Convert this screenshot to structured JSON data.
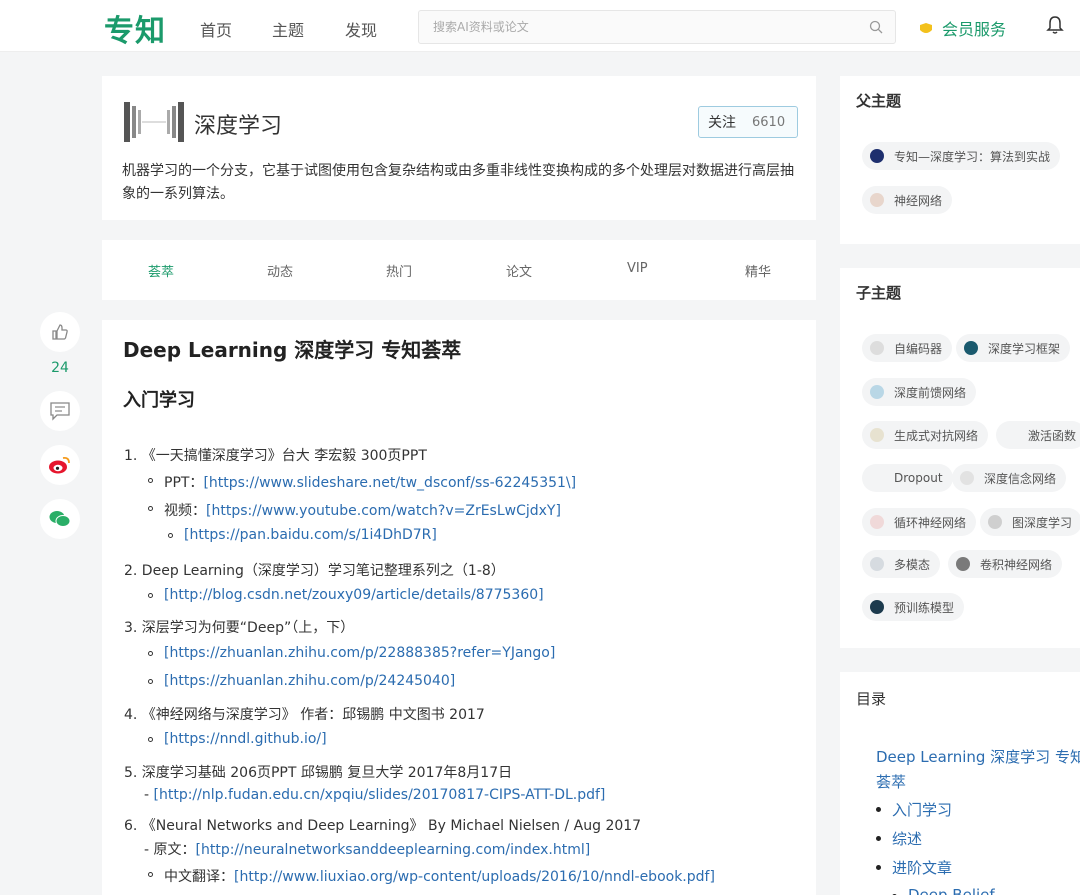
{
  "nav": {
    "logo": "专知",
    "items": [
      "首页",
      "主题",
      "发现"
    ],
    "search_placeholder": "搜索AI资料或论文",
    "vip_label": "会员服务",
    "brand_color": "#1b9a6b"
  },
  "social": {
    "like_count": "24"
  },
  "topic": {
    "title": "深度学习",
    "follow_label": "关注",
    "follow_count": "6610",
    "description": "机器学习的一个分支，它基于试图使用包含复杂结构或由多重非线性变换构成的多个处理层对数据进行高层抽象的一系列算法。"
  },
  "tabs": [
    "荟萃",
    "动态",
    "热门",
    "论文",
    "VIP",
    "精华"
  ],
  "article": {
    "title": "Deep Learning 深度学习 专知荟萃",
    "section": "入门学习",
    "lines": [
      {
        "pre": "1. 《一天搞懂深度学习》台大 李宏毅 300页PPT",
        "link": ""
      },
      {
        "pre": "PPT：",
        "link": "[https://www.slideshare.net/tw_dsconf/ss-62245351\\]"
      },
      {
        "pre": "视频：",
        "link": "[https://www.youtube.com/watch?v=ZrEsLwCjdxY]"
      },
      {
        "pre": "",
        "link": "[https://pan.baidu.com/s/1i4DhD7R]"
      },
      {
        "pre": "2. Deep Learning（深度学习）学习笔记整理系列之（1-8）",
        "link": ""
      },
      {
        "pre": "",
        "link": "[http://blog.csdn.net/zouxy09/article/details/8775360]"
      },
      {
        "pre": "3. 深层学习为何要“Deep”（上，下）",
        "link": ""
      },
      {
        "pre": "",
        "link": "[https://zhuanlan.zhihu.com/p/22888385?refer=YJango]"
      },
      {
        "pre": "",
        "link": "[https://zhuanlan.zhihu.com/p/24245040]"
      },
      {
        "pre": "4. 《神经网络与深度学习》 作者：邱锡鹏 中文图书 2017",
        "link": ""
      },
      {
        "pre": "",
        "link": "[https://nndl.github.io/]"
      },
      {
        "pre": "5. 深度学习基础 206页PPT 邱锡鹏 复旦大学 2017年8月17日",
        "link": ""
      },
      {
        "pre": "- ",
        "link": "[http://nlp.fudan.edu.cn/xpqiu/slides/20170817-CIPS-ATT-DL.pdf]"
      },
      {
        "pre": "6. 《Neural Networks and Deep Learning》 By Michael Nielsen / Aug 2017",
        "link": ""
      },
      {
        "pre": "- 原文：",
        "link": "[http://neuralnetworksanddeeplearning.com/index.html]"
      },
      {
        "pre": "中文翻译：",
        "link": "[http://www.liuxiao.org/wp-content/uploads/2016/10/nndl-ebook.pdf]"
      }
    ]
  },
  "parent_topics": {
    "heading": "父主题",
    "items": [
      "专知—深度学习：算法到实战",
      "神经网络"
    ]
  },
  "child_topics": {
    "heading": "子主题",
    "items": [
      "自编码器",
      "深度学习框架",
      "深度前馈网络",
      "生成式对抗网络",
      "激活函数",
      "Dropout",
      "深度信念网络",
      "循环神经网络",
      "图深度学习",
      "多模态",
      "卷积神经网络",
      "预训练模型"
    ]
  },
  "toc": {
    "heading": "目录",
    "title_line1": "Deep Learning 深度学习 专知",
    "title_line2": "荟萃",
    "items": [
      "入门学习",
      "综述",
      "进阶文章",
      "Deep Belief"
    ]
  }
}
